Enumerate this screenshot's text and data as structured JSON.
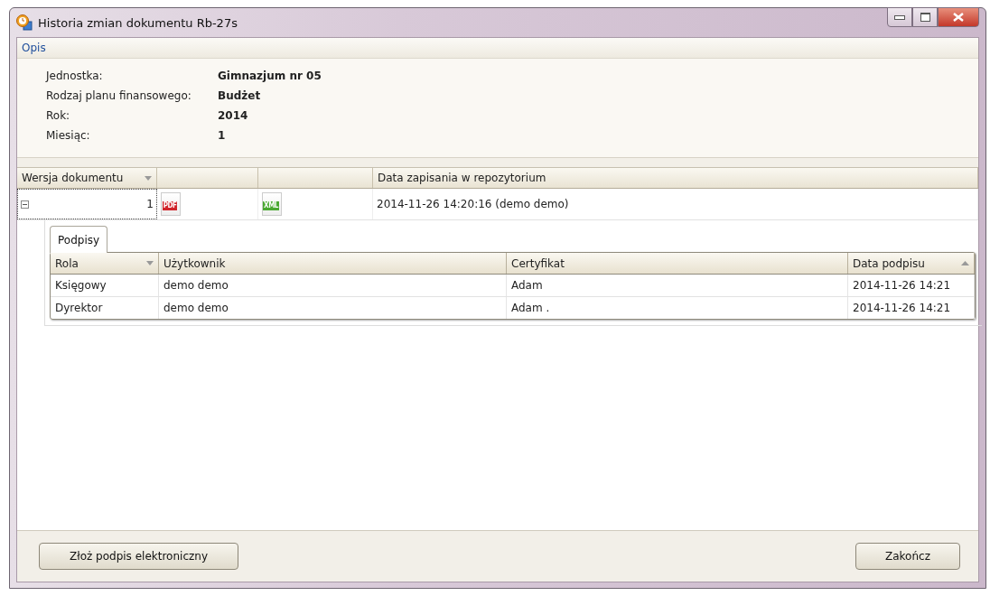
{
  "window": {
    "title": "Historia zmian dokumentu Rb-27s"
  },
  "section": {
    "title": "Opis"
  },
  "details": [
    {
      "label": "Jednostka:",
      "value": "Gimnazjum nr 05"
    },
    {
      "label": "Rodzaj planu finansowego:",
      "value": "Budżet"
    },
    {
      "label": "Rok:",
      "value": "2014"
    },
    {
      "label": "Miesiąc:",
      "value": "1"
    }
  ],
  "versions": {
    "columns": [
      {
        "label": "Wersja dokumentu",
        "filter_menu": true
      },
      {},
      {},
      {
        "label": "Data zapisania w repozytorium"
      }
    ],
    "rows": [
      {
        "version": "1",
        "expanded": true,
        "files": [
          {
            "kind": "pdf",
            "label": "PDF"
          },
          {
            "kind": "xml",
            "label": "XML"
          }
        ],
        "saved": "2014-11-26 14:20:16 (demo demo)",
        "detail": {
          "tabs": [
            {
              "label": "Podpisy",
              "selected": true
            }
          ],
          "columns": [
            {
              "label": "Rola",
              "filter_menu": true
            },
            {
              "label": "Użytkownik"
            },
            {
              "label": "Certyfikat"
            },
            {
              "label": "Data podpisu",
              "sorted_ascending": true
            }
          ],
          "rows": [
            [
              "Księgowy",
              "demo demo",
              "Adam",
              "2014-11-26 14:21"
            ],
            [
              "Dyrektor",
              "demo demo",
              "Adam .",
              "2014-11-26 14:21"
            ]
          ]
        }
      }
    ]
  },
  "buttons": [
    {
      "label": "Złoż podpis elektroniczny"
    },
    {
      "label": "Zakończ"
    }
  ]
}
